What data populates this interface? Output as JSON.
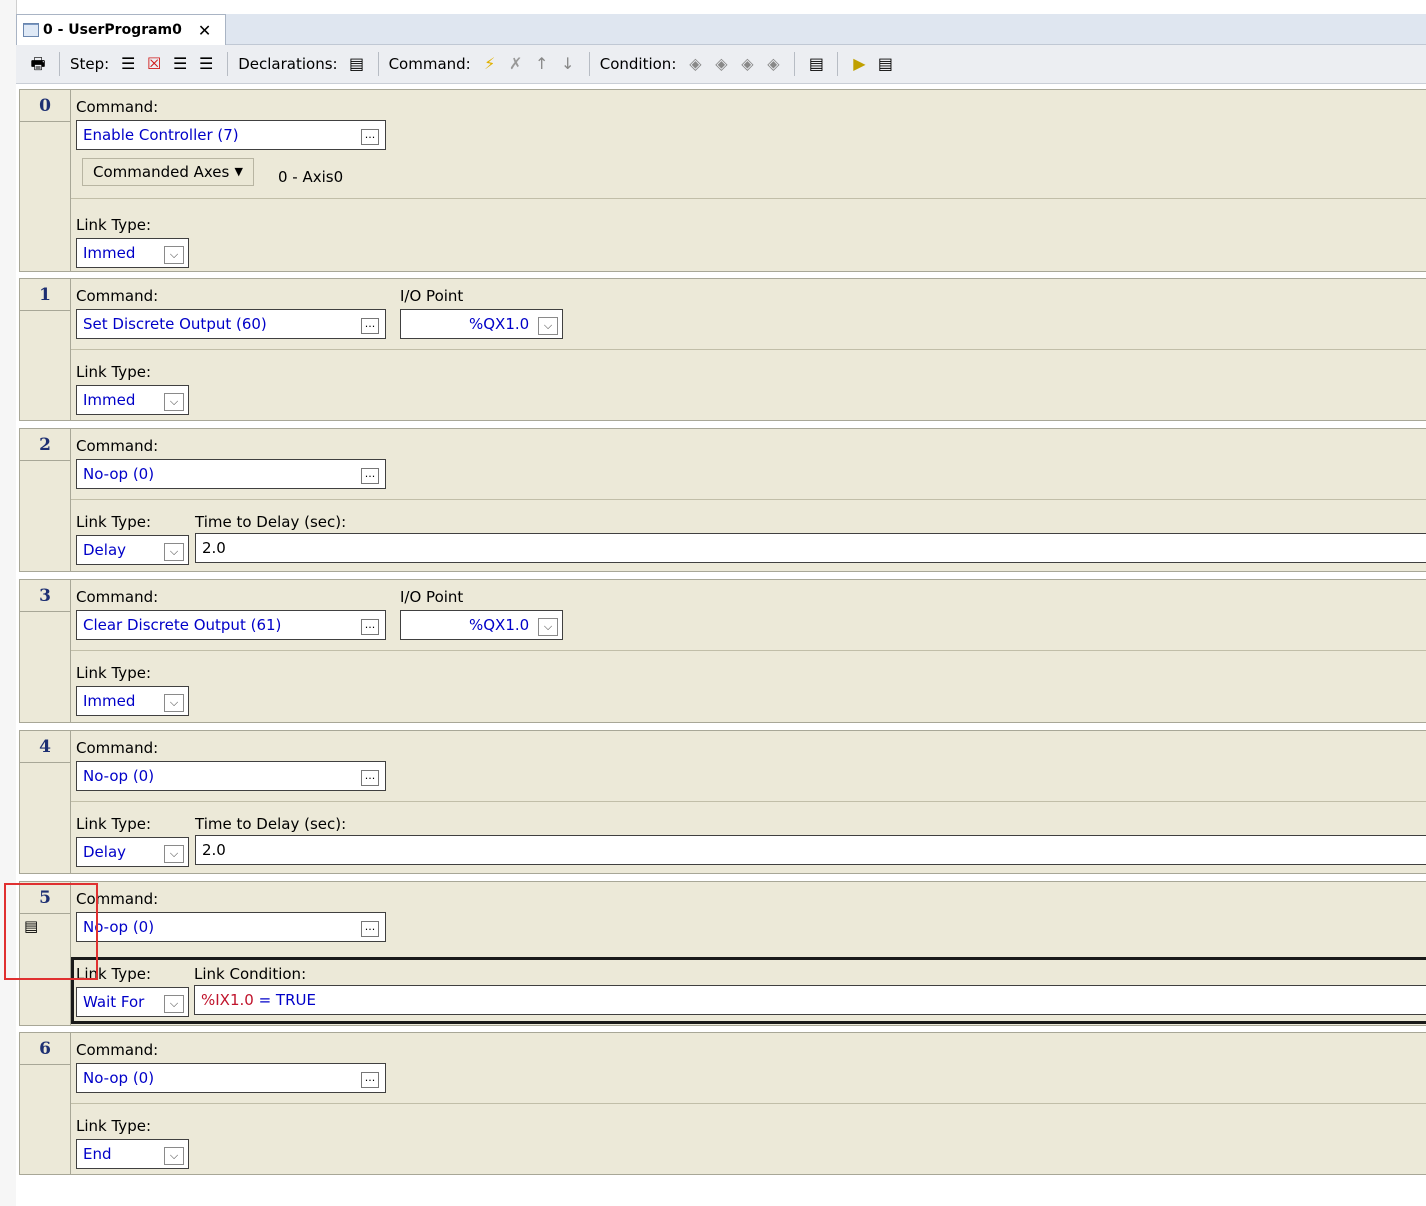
{
  "tab": {
    "title": "0 - UserProgram0",
    "close": "✕"
  },
  "toolbar": {
    "print_icon": "🖶",
    "step_label": "Step:",
    "declarations_label": "Declarations:",
    "command_label": "Command:",
    "condition_label": "Condition:"
  },
  "common": {
    "command_label": "Command:",
    "link_type_label": "Link Type:",
    "io_point_label": "I/O Point",
    "delay_label": "Time to Delay (sec):",
    "link_condition_label": "Link Condition:",
    "ellipsis": "...",
    "dropdown": "⌵"
  },
  "steps": [
    {
      "num": "0",
      "command": "Enable Controller (7)",
      "axes_label": "Commanded Axes",
      "axes_value": "0 - Axis0",
      "link_type": "Immed"
    },
    {
      "num": "1",
      "command": "Set Discrete Output (60)",
      "io_point": "%QX1.0",
      "link_type": "Immed"
    },
    {
      "num": "2",
      "command": "No-op (0)",
      "link_type": "Delay",
      "delay": "2.0"
    },
    {
      "num": "3",
      "command": "Clear Discrete Output (61)",
      "io_point": "%QX1.0",
      "link_type": "Immed"
    },
    {
      "num": "4",
      "command": "No-op (0)",
      "link_type": "Delay",
      "delay": "2.0"
    },
    {
      "num": "5",
      "command": "No-op (0)",
      "link_type": "Wait For",
      "condition_var": "%IX1.0",
      "condition_rest": " = TRUE"
    },
    {
      "num": "6",
      "command": "No-op (0)",
      "link_type": "End"
    }
  ]
}
